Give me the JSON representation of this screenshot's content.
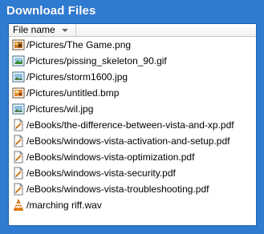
{
  "window": {
    "title": "Download Files"
  },
  "list": {
    "column_header": "File name",
    "files": [
      {
        "name": "/Pictures/The Game.png",
        "icon": "png-image-icon"
      },
      {
        "name": "/Pictures/pissing_skeleton_90.gif",
        "icon": "gif-image-icon"
      },
      {
        "name": "/Pictures/storm1600.jpg",
        "icon": "jpg-image-icon"
      },
      {
        "name": "/Pictures/untitled.bmp",
        "icon": "bmp-image-icon"
      },
      {
        "name": "/Pictures/wil.jpg",
        "icon": "jpg-image-icon"
      },
      {
        "name": "/eBooks/the-difference-between-vista-and-xp.pdf",
        "icon": "pdf-document-icon"
      },
      {
        "name": "/eBooks/windows-vista-activation-and-setup.pdf",
        "icon": "pdf-document-icon"
      },
      {
        "name": "/eBooks/windows-vista-optimization.pdf",
        "icon": "pdf-document-icon"
      },
      {
        "name": "/eBooks/windows-vista-security.pdf",
        "icon": "pdf-document-icon"
      },
      {
        "name": "/eBooks/windows-vista-troubleshooting.pdf",
        "icon": "pdf-document-icon"
      },
      {
        "name": "/marching riff.wav",
        "icon": "vlc-media-icon"
      }
    ]
  },
  "colors": {
    "background": "#2f7bd2",
    "panel_border": "#1f5fae"
  }
}
